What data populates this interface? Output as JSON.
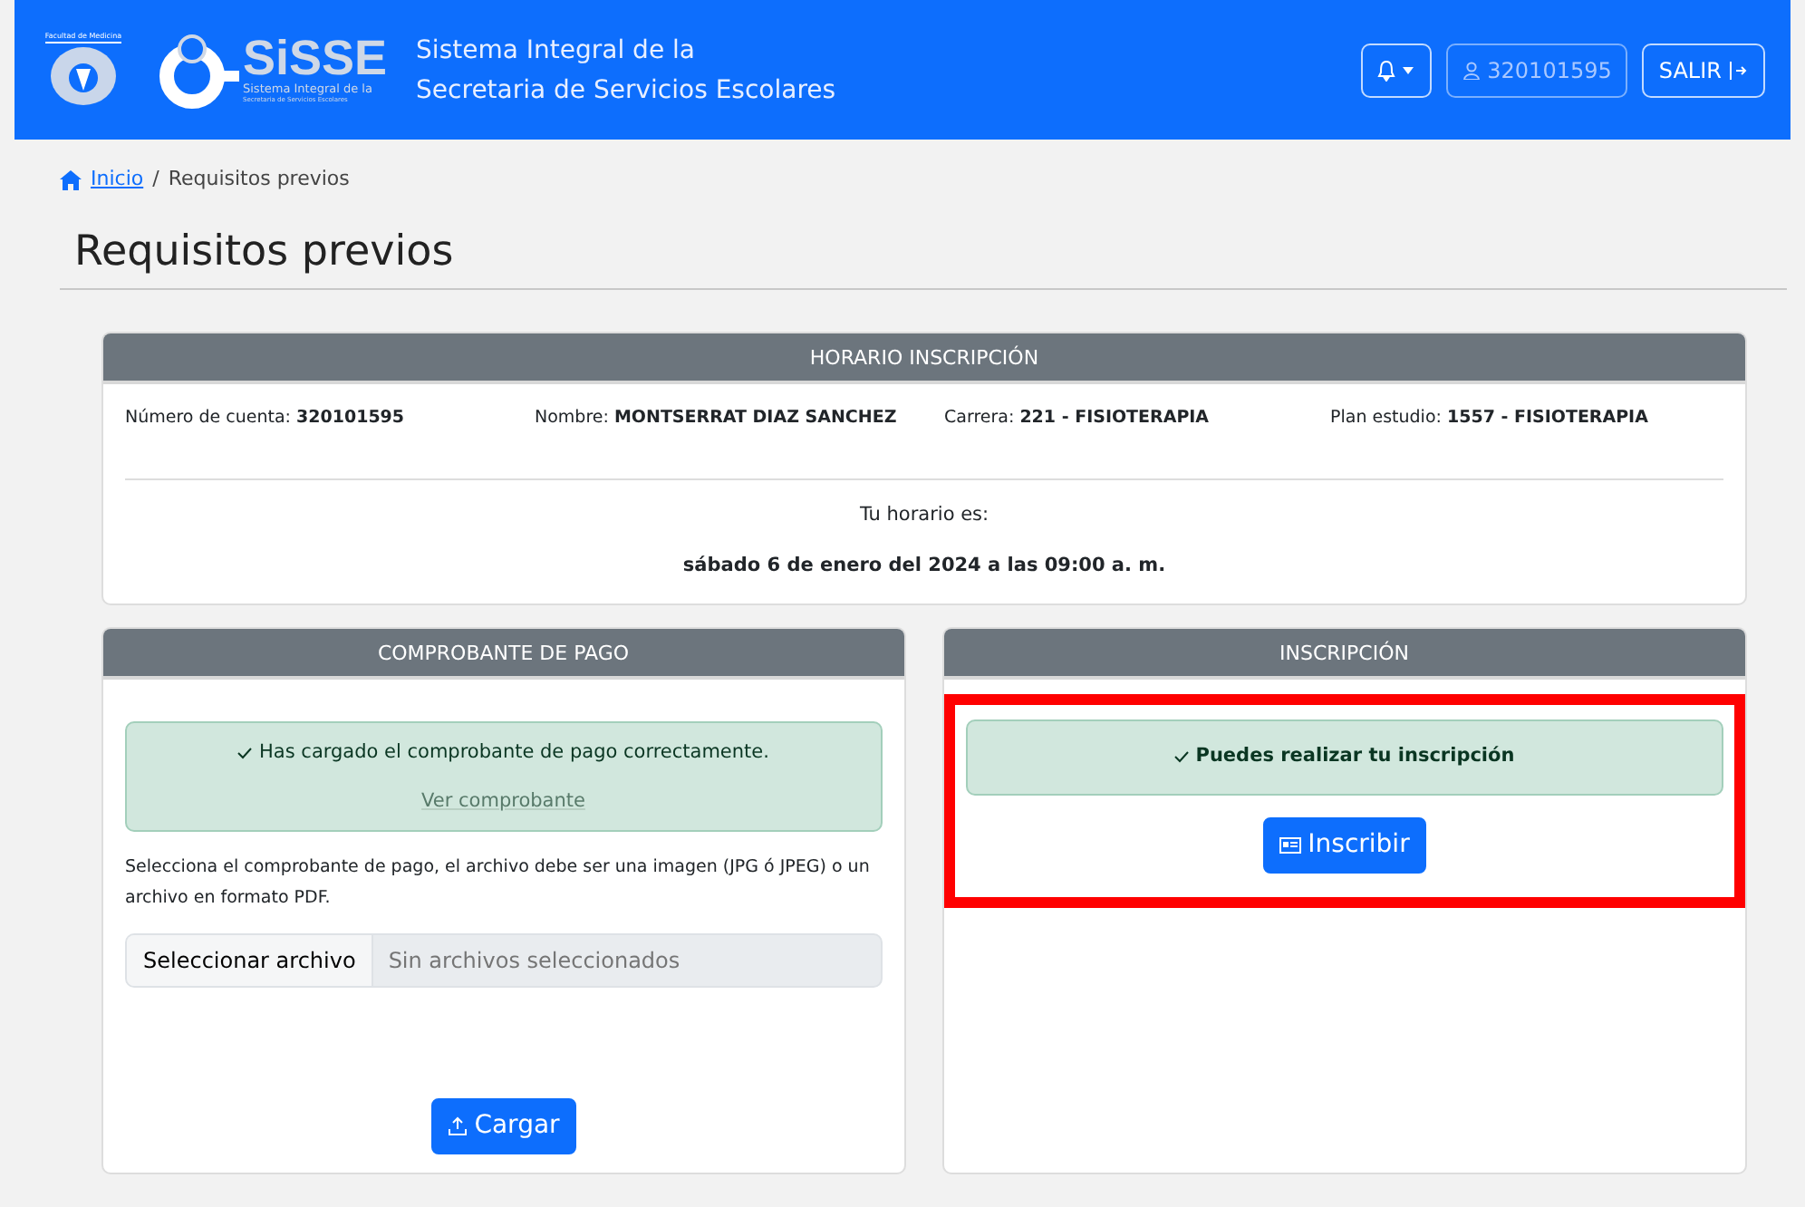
{
  "header": {
    "faculty_label": "Facultad de Medicina",
    "logo": {
      "name": "SiSSE",
      "line_1": "Sistema Integral de la",
      "line_2": "Secretaria de Servicios Escolares"
    },
    "title_lines": [
      "Sistema Integral de la",
      "Secretaria de Servicios Escolares"
    ],
    "user": "320101595",
    "logout": "SALIR"
  },
  "breadcrumb_separator": "/",
  "breadcrumb": [
    {
      "label": "Inicio",
      "link": true
    },
    {
      "label": "Requisitos previos",
      "link": false
    }
  ],
  "page_title": "Requisitos previos",
  "schedule_card": {
    "title": "HORARIO INSCRIPCIÓN",
    "fields": [
      {
        "label": "Número de cuenta:",
        "value": "320101595"
      },
      {
        "label": "Nombre:",
        "value": "MONTSERRAT DIAZ SANCHEZ"
      },
      {
        "label": "Carrera:",
        "value": "221 - FISIOTERAPIA"
      },
      {
        "label": "Plan estudio:",
        "value": "1557 - FISIOTERAPIA"
      }
    ],
    "schedule_label": "Tu horario es:",
    "schedule_value": "sábado 6 de enero del 2024 a las 09:00 a. m."
  },
  "payment_card": {
    "title": "COMPROBANTE DE PAGO",
    "alert": "Has cargado el comprobante de pago correctamente.",
    "alert_link": "Ver comprobante",
    "instructions": "Selecciona el comprobante de pago, el archivo debe ser una imagen (JPG ó JPEG) o un archivo en formato PDF.",
    "file_button": "Seleccionar archivo",
    "file_placeholder": "Sin archivos seleccionados",
    "upload_button": "Cargar"
  },
  "enrollment_card": {
    "title": "INSCRIPCIÓN",
    "highlighted": true,
    "alert": "Puedes realizar tu inscripción",
    "button": "Inscribir"
  }
}
